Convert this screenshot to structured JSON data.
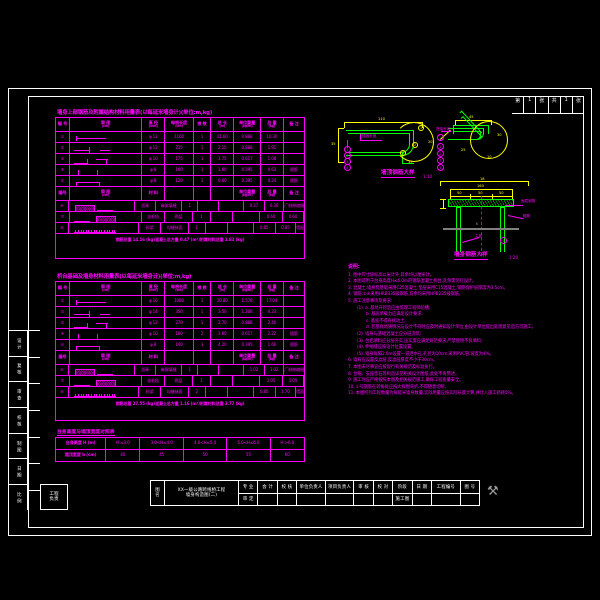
{
  "sheet": {
    "background": "#000000",
    "line_color": "#ffffff",
    "entity_color": "#ff00ff",
    "rebar_color": "#00ff00",
    "dim_color": "#ffff00",
    "center_color": "#ff0000"
  },
  "sheet_number_box": {
    "cells": [
      "第",
      "1",
      "张",
      "共",
      "1",
      "张"
    ]
  },
  "revision_strip": {
    "cells": [
      "设 计",
      "复 核",
      "审 查",
      "校 核",
      "制 图",
      "日 期",
      "比 例"
    ],
    "bottom_box": "工程\n负责"
  },
  "table1": {
    "title": "墙身上部钢筋及附属结构材料用量表(以每延米墙身计)(单位:m,kg)",
    "headers": [
      {
        "main": "编 号",
        "sub": ""
      },
      {
        "main": "简 图",
        "sub": "(cm)"
      },
      {
        "main": "直 径",
        "sub": "(mm)"
      },
      {
        "main": "每根长度",
        "sub": "(cm)"
      },
      {
        "main": "根 数",
        "sub": ""
      },
      {
        "main": "总 长",
        "sub": "(m)"
      },
      {
        "main": "单位重量",
        "sub": "(kg/m)"
      },
      {
        "main": "总 重",
        "sub": "(kg)"
      },
      {
        "main": "备 注",
        "sub": ""
      }
    ],
    "rows": [
      [
        "①",
        "FIG",
        "φ 12",
        "1160",
        "1",
        "11.60",
        "0.888",
        "10.30",
        ""
      ],
      [
        "②",
        "FIG",
        "φ 12",
        "215",
        "1",
        "2.15",
        "0.888",
        "1.91",
        ""
      ],
      [
        "③",
        "FIG",
        "φ 10",
        "175",
        "1",
        "1.75",
        "0.617",
        "1.08",
        ""
      ],
      [
        "④",
        "FIG",
        "φ 8",
        "160",
        "1",
        "1.60",
        "0.395",
        "0.63",
        "箍筋"
      ],
      [
        "⑤",
        "FIG",
        "φ 8",
        "120",
        "1",
        "0.60",
        "0.395",
        "0.24",
        "箍筋"
      ]
    ],
    "headers2": [
      {
        "main": "编号",
        "sub": ""
      },
      {
        "main": "简 图",
        "sub": "(cm)"
      },
      {
        "main": "材 料",
        "sub": ""
      },
      {
        "main": "",
        "sub": ""
      },
      {
        "main": "",
        "sub": ""
      },
      {
        "main": "",
        "sub": ""
      },
      {
        "main": "单位重量",
        "sub": "(kg/m)"
      },
      {
        "main": "总 量",
        "sub": "(kg)"
      },
      {
        "main": "备 注",
        "sub": ""
      }
    ],
    "rows2": [
      [
        "⑥",
        "FIG",
        "沥青",
        "麻絮填缝",
        "1",
        "",
        "",
        "0.37",
        "0.38",
        "厂制伸缩缝"
      ],
      [
        "⑦",
        "FIG",
        "油毛毡",
        "两层",
        "1",
        "",
        "",
        "0.60",
        "0.60",
        ""
      ],
      [
        "⑧",
        "FIG",
        "砂浆",
        "勾缝抹面",
        "1",
        "",
        "",
        "0.85",
        "0.85",
        "墙面"
      ]
    ],
    "totals": [
      "钢筋总重 14.16 (kg)",
      "混凝土总方量 0.47 (m³)",
      "附属材料总重 1.83 (kg)"
    ]
  },
  "table2": {
    "title": "桥台基础及墙身材料用量表(以每延米墙身计)(单位:m,kg)",
    "headers": [
      {
        "main": "编 号",
        "sub": ""
      },
      {
        "main": "简 图",
        "sub": "(cm)"
      },
      {
        "main": "直 径",
        "sub": "(mm)"
      },
      {
        "main": "每根长度",
        "sub": "(cm)"
      },
      {
        "main": "根 数",
        "sub": ""
      },
      {
        "main": "总 长",
        "sub": "(m)"
      },
      {
        "main": "单位重量",
        "sub": "(kg/m)"
      },
      {
        "main": "总 重",
        "sub": "(kg)"
      },
      {
        "main": "备 注",
        "sub": ""
      }
    ],
    "rows": [
      [
        "①",
        "FIG",
        "φ 16",
        "1080",
        "1",
        "10.80",
        "1.578",
        "17.04",
        ""
      ],
      [
        "②",
        "FIG",
        "φ 14",
        "350",
        "1",
        "3.50",
        "1.208",
        "4.23",
        ""
      ],
      [
        "③",
        "FIG",
        "φ 12",
        "270",
        "1",
        "2.70",
        "0.888",
        "2.40",
        ""
      ],
      [
        "④",
        "FIG",
        "φ 10",
        "180",
        "2",
        "3.60",
        "0.617",
        "2.22",
        "箍筋"
      ],
      [
        "⑤",
        "FIG",
        "φ 8",
        "140",
        "3",
        "4.20",
        "0.395",
        "1.66",
        "箍筋"
      ]
    ],
    "headers2": [
      {
        "main": "编号",
        "sub": ""
      },
      {
        "main": "简 图",
        "sub": "(cm)"
      },
      {
        "main": "材 料",
        "sub": ""
      },
      {
        "main": "",
        "sub": ""
      },
      {
        "main": "",
        "sub": ""
      },
      {
        "main": "",
        "sub": ""
      },
      {
        "main": "单位重量",
        "sub": "(kg/m)"
      },
      {
        "main": "总 量",
        "sub": "(kg)"
      },
      {
        "main": "备 注",
        "sub": ""
      }
    ],
    "rows2": [
      [
        "⑥",
        "FIG",
        "沥青",
        "麻絮填缝",
        "1",
        "",
        "",
        "1.02",
        "1.02",
        "厂制伸缩缝"
      ],
      [
        "⑦",
        "FIG",
        "油毛毡",
        "两层",
        "1",
        "",
        "",
        "1.05",
        "1.05",
        ""
      ],
      [
        "⑧",
        "FIG",
        "砂浆",
        "勾缝抹面",
        "2",
        "",
        "",
        "0.85",
        "1.70",
        "墙面"
      ]
    ],
    "totals": [
      "钢筋总重 27.55 (kg)",
      "混凝土总方量 1.16 (m³)",
      "附属材料总重 3.77 (kg)"
    ]
  },
  "table3": {
    "title": "台身高度与墙顶宽度对照表",
    "row1_label": "台身高度 H (m)",
    "row1_values": [
      "H ≤3.0",
      "3.0<H≤4.0",
      "4.0<H≤5.0",
      "5.0<H≤6.0",
      "H >6.0"
    ],
    "row2_label": "墙顶宽度 b (cm)",
    "row2_values": [
      "40",
      "45",
      "50",
      "55",
      "60"
    ]
  },
  "details": {
    "detail1": {
      "label": "墙顶钢筋大样",
      "scale": "1:10",
      "tag": "锚固长度",
      "bubbles": [
        "1",
        "2",
        "3",
        "4"
      ],
      "bubbles_right": [
        "1",
        "2",
        "3",
        "4",
        "5"
      ],
      "dims": [
        "110",
        "35",
        "20",
        "15",
        "8",
        "12"
      ]
    },
    "detail2": {
      "label": "弯折钢筋大样",
      "scale": "1:10",
      "tag": "搭接长度",
      "dims": [
        "45",
        "30",
        "25",
        "10",
        "18"
      ]
    },
    "detail3": {
      "label": "墙身钢筋大样",
      "scale": "1:20",
      "dims": [
        "160",
        "50",
        "50",
        "50",
        "30"
      ],
      "tags": [
        "面层钢筋",
        "箍筋",
        "主筋"
      ],
      "bubble": "1"
    }
  },
  "notes": {
    "heading": "说明:",
    "items": [
      {
        "indent": 0,
        "text": "1. 图中尺寸除标高以米计外,其余均以厘米计。"
      },
      {
        "indent": 0,
        "text": "2. 本图适用于台身高度H≤6.0m的钢筋混凝土桥台,其余需另行设计。"
      },
      {
        "indent": 0,
        "text": "3. 混凝土:墙身及基础采用C25混凝土;垫层采用C15混凝土;钢筋保护层厚度为3.5cm。"
      },
      {
        "indent": 0,
        "text": "4. 钢筋:①④采用HRB335级钢筋,其余均采用HPB235级钢筋。"
      },
      {
        "indent": 0,
        "text": "5. 施工注意事项及要求:"
      },
      {
        "indent": 1,
        "text": "(1). a. 基坑开挖后应由监理工程师验槽;"
      },
      {
        "indent": 2,
        "text": "b. 基底承载力应满足设计要求;"
      },
      {
        "indent": 2,
        "text": "c. 基底不得有扰动土;"
      },
      {
        "indent": 2,
        "text": "d. 若基底地质情况与设计不符时应及时通知设计单位,由设计单位提出处理意见后方可施工。"
      },
      {
        "indent": 1,
        "text": "(2). 墙身与基础混凝土应分层浇筑;"
      },
      {
        "indent": 1,
        "text": "(3). 台后填料应分层夯实,压实度应满足规范要求,严禁使用不良填料;"
      },
      {
        "indent": 1,
        "text": "(4). 伸缩缝应按设计位置设置;"
      },
      {
        "indent": 1,
        "text": "(5). 墙身每隔2.0m设置一道泄水孔,孔径为10cm,采用PVC管,坡度为4%。"
      },
      {
        "indent": 0,
        "text": "6. 墙背应设置反滤层,反滤层厚度不小于30cm。"
      },
      {
        "indent": 0,
        "text": "7. 本图未尽事宜应按现行有关规范及标准执行。"
      },
      {
        "indent": 0,
        "text": "8. 台帽、支座垫石等构造详见相关设计图纸,此处不再赘述。"
      },
      {
        "indent": 0,
        "text": "9. 施工时应严格按照本图及相关规范施工,确保工程质量安全。"
      },
      {
        "indent": 0,
        "text": "10. ①号钢筋在转角处应按大样图弯折,不得随意切断。"
      },
      {
        "indent": 0,
        "text": "11. 本图所列工程数量为每延米墙身数量,实际用量应按实际长度计算,并计入施工损耗5%。"
      }
    ]
  },
  "title_block": {
    "left_label": "图\n名",
    "drawing_name_line1": "XX一级公路跨线桥工程",
    "drawing_name_line2": "墙身构造图(二)",
    "columns": [
      {
        "top": "专 业",
        "bottom": "审 定"
      },
      {
        "top": "会 计",
        "bottom": ""
      },
      {
        "top": "校 核",
        "bottom": ""
      },
      {
        "top": "单位负责人",
        "bottom": ""
      },
      {
        "top": "项目负责人",
        "bottom": ""
      },
      {
        "top": "审 核",
        "bottom": ""
      },
      {
        "top": "校 对",
        "bottom": ""
      },
      {
        "top": "阶段",
        "bottom": "施工图"
      },
      {
        "top": "日 期",
        "bottom": ""
      },
      {
        "top": "工程编号",
        "bottom": ""
      },
      {
        "top": "图 号",
        "bottom": ""
      }
    ],
    "stamp": "⚒"
  }
}
